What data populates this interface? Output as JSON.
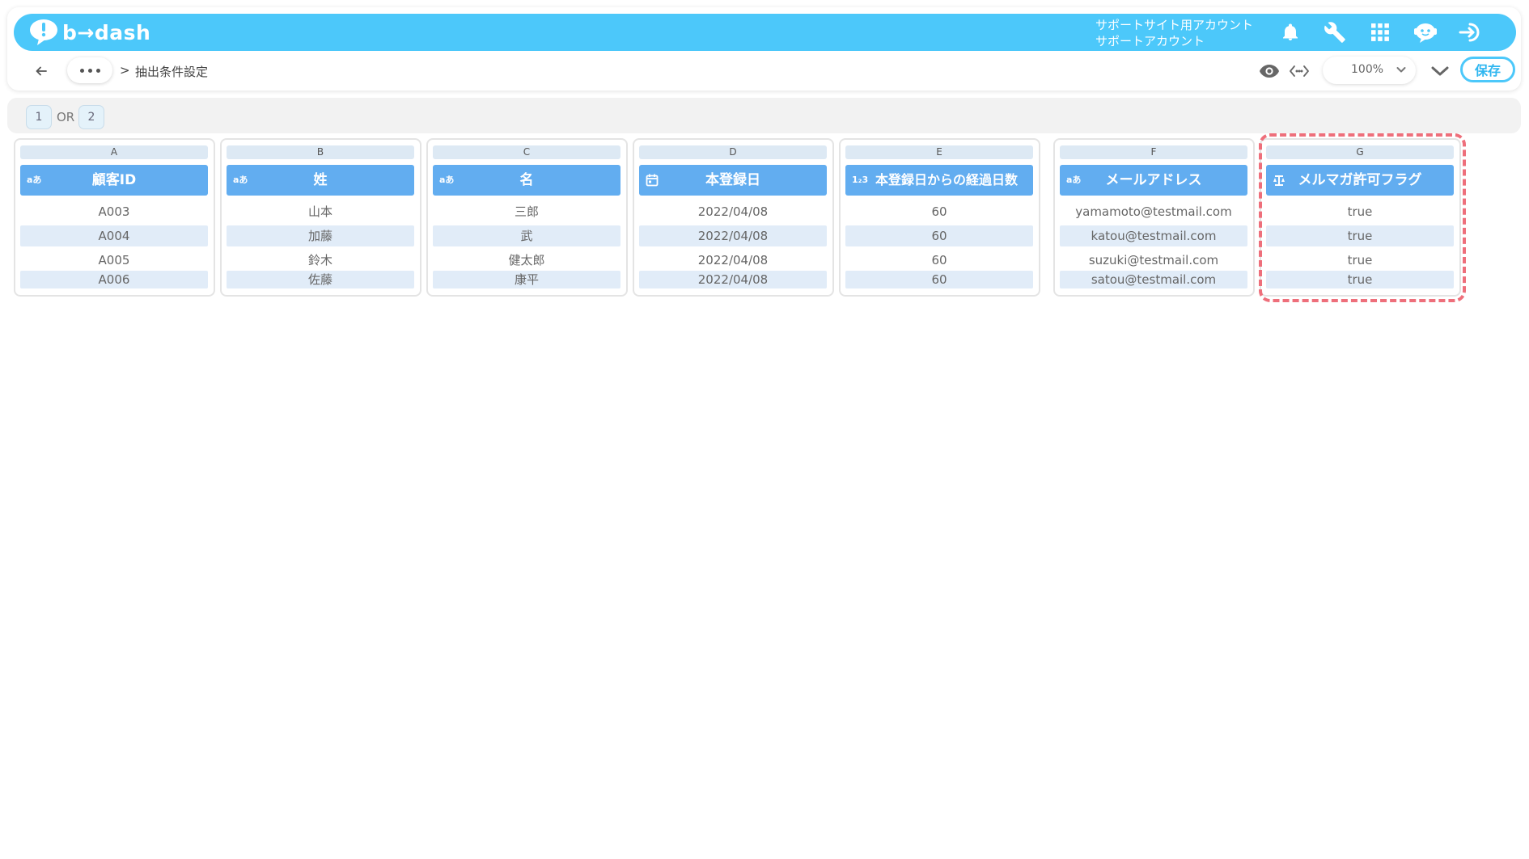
{
  "header": {
    "logo_text": "b→dash",
    "account_line1": "サポートサイト用アカウント",
    "account_line2": "サポートアカウント",
    "icons": [
      "bell-icon",
      "wrench-icon",
      "apps-grid-icon",
      "chat-bot-icon",
      "logout-icon"
    ]
  },
  "subbar": {
    "breadcrumb_sep": ">",
    "breadcrumb": "抽出条件設定",
    "zoom": "100%",
    "save_label": "保存"
  },
  "conditions": {
    "chip1": "1",
    "operator": "OR",
    "chip2": "2"
  },
  "columns": [
    {
      "letter": "A",
      "type": "text",
      "type_label": "aあ",
      "name": "顧客ID",
      "cells": [
        "A003",
        "A004",
        "A005",
        "A006"
      ]
    },
    {
      "letter": "B",
      "type": "text",
      "type_label": "aあ",
      "name": "姓",
      "cells": [
        "山本",
        "加藤",
        "鈴木",
        "佐藤"
      ]
    },
    {
      "letter": "C",
      "type": "text",
      "type_label": "aあ",
      "name": "名",
      "cells": [
        "三郎",
        "武",
        "健太郎",
        "康平"
      ]
    },
    {
      "letter": "D",
      "type": "date",
      "type_label": "",
      "name": "本登録日",
      "cells": [
        "2022/04/08",
        "2022/04/08",
        "2022/04/08",
        "2022/04/08"
      ]
    },
    {
      "letter": "E",
      "type": "number",
      "type_label": "1₂3",
      "name": "本登録日からの経過日数",
      "cells": [
        "60",
        "60",
        "60",
        "60"
      ]
    },
    {
      "letter": "F",
      "type": "text",
      "type_label": "aあ",
      "name": "メールアドレス",
      "cells": [
        "yamamoto@testmail.com",
        "katou@testmail.com",
        "suzuki@testmail.com",
        "satou@testmail.com"
      ]
    },
    {
      "letter": "G",
      "type": "boolean",
      "type_label": "",
      "name": "メルマガ許可フラグ",
      "cells": [
        "true",
        "true",
        "true",
        "true"
      ]
    }
  ],
  "colors": {
    "topbar": "#4cc8fa",
    "column_header": "#62adf0",
    "alt_row": "#e1ecf8",
    "highlight": "#ee6f7b"
  }
}
